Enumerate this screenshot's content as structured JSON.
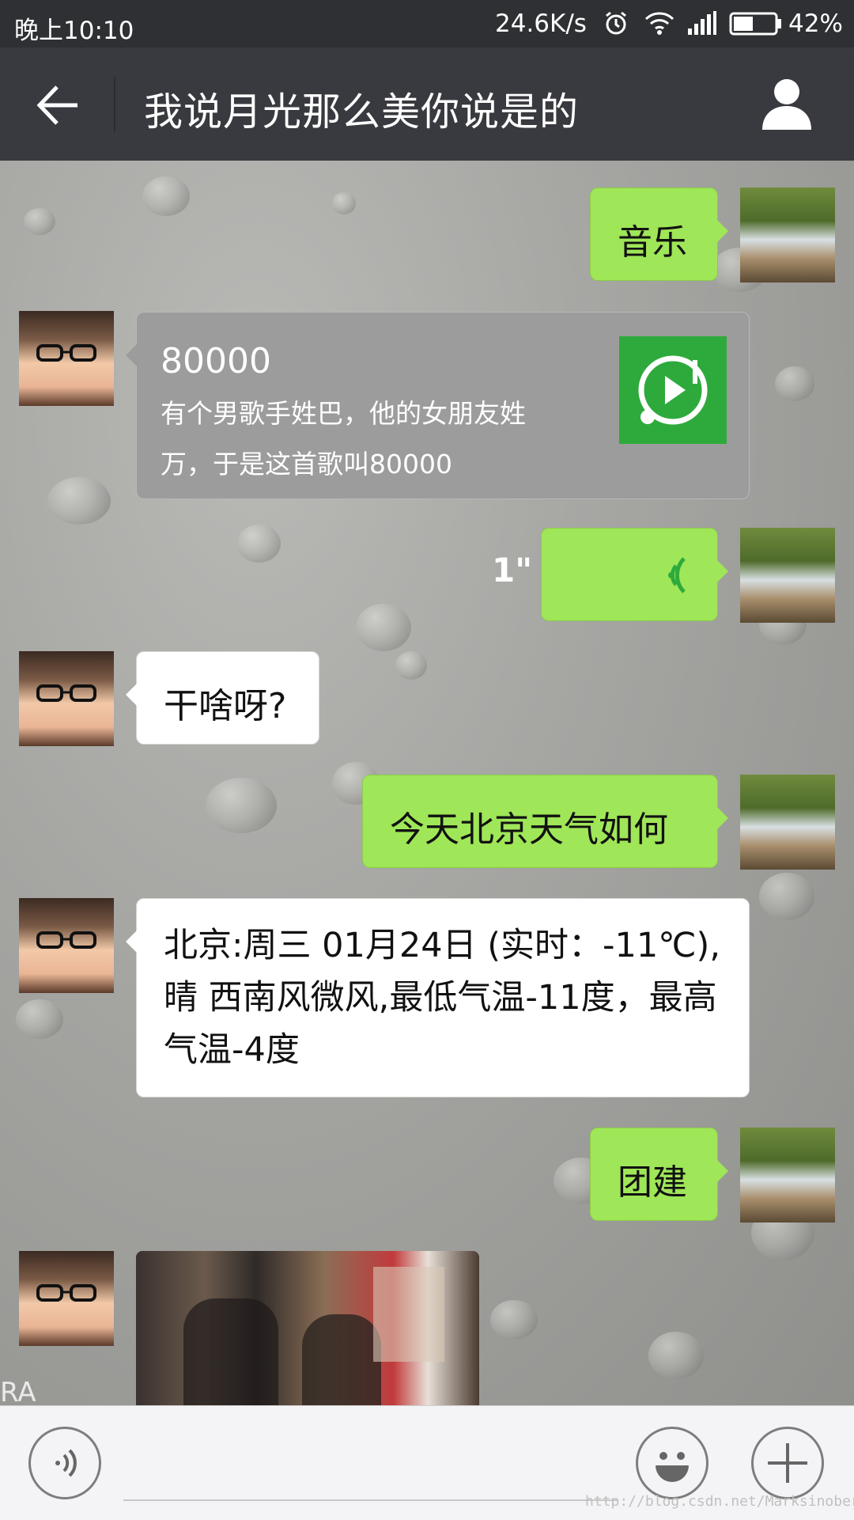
{
  "status_bar": {
    "time": "晚上10:10",
    "net_speed": "24.6K/s",
    "battery": "42%",
    "icons": [
      "alarm-icon",
      "wifi-icon",
      "signal-icon",
      "battery-icon"
    ]
  },
  "header": {
    "title": "我说月光那么美你说是的",
    "back_icon": "back-arrow-icon",
    "profile_icon": "profile-icon"
  },
  "messages": {
    "m1": {
      "sender": "self",
      "type": "text",
      "text": "音乐"
    },
    "m2": {
      "sender": "other",
      "type": "music",
      "title": "80000",
      "desc": "有个男歌手姓巴，他的女朋友姓万，于是这首歌叫80000",
      "icon": "music-play-icon"
    },
    "m3": {
      "sender": "self",
      "type": "voice",
      "duration": "1\""
    },
    "m4": {
      "sender": "other",
      "type": "text",
      "text": "干啥呀?"
    },
    "m5": {
      "sender": "self",
      "type": "text",
      "text": "今天北京天气如何"
    },
    "m6": {
      "sender": "other",
      "type": "text",
      "text": "北京:周三 01月24日 (实时：-11℃),晴 西南风微风,最低气温-11度，最高气温-4度"
    },
    "m7": {
      "sender": "self",
      "type": "text",
      "text": "团建"
    },
    "m8": {
      "sender": "other",
      "type": "image"
    }
  },
  "overlay_text": "RA",
  "input_bar": {
    "voice_icon": "voice-input-icon",
    "emoji_icon": "emoji-icon",
    "plus_icon": "plus-icon"
  },
  "watermark": "http://blog.csdn.net/Marksinoberg",
  "colors": {
    "status_bg": "#2e3033",
    "header_bg": "#393a3f",
    "bubble_self": "#9fe658",
    "bubble_other": "#ffffff",
    "music_card": "#9c9c9c",
    "music_icon_bg": "#2eaa3c"
  }
}
